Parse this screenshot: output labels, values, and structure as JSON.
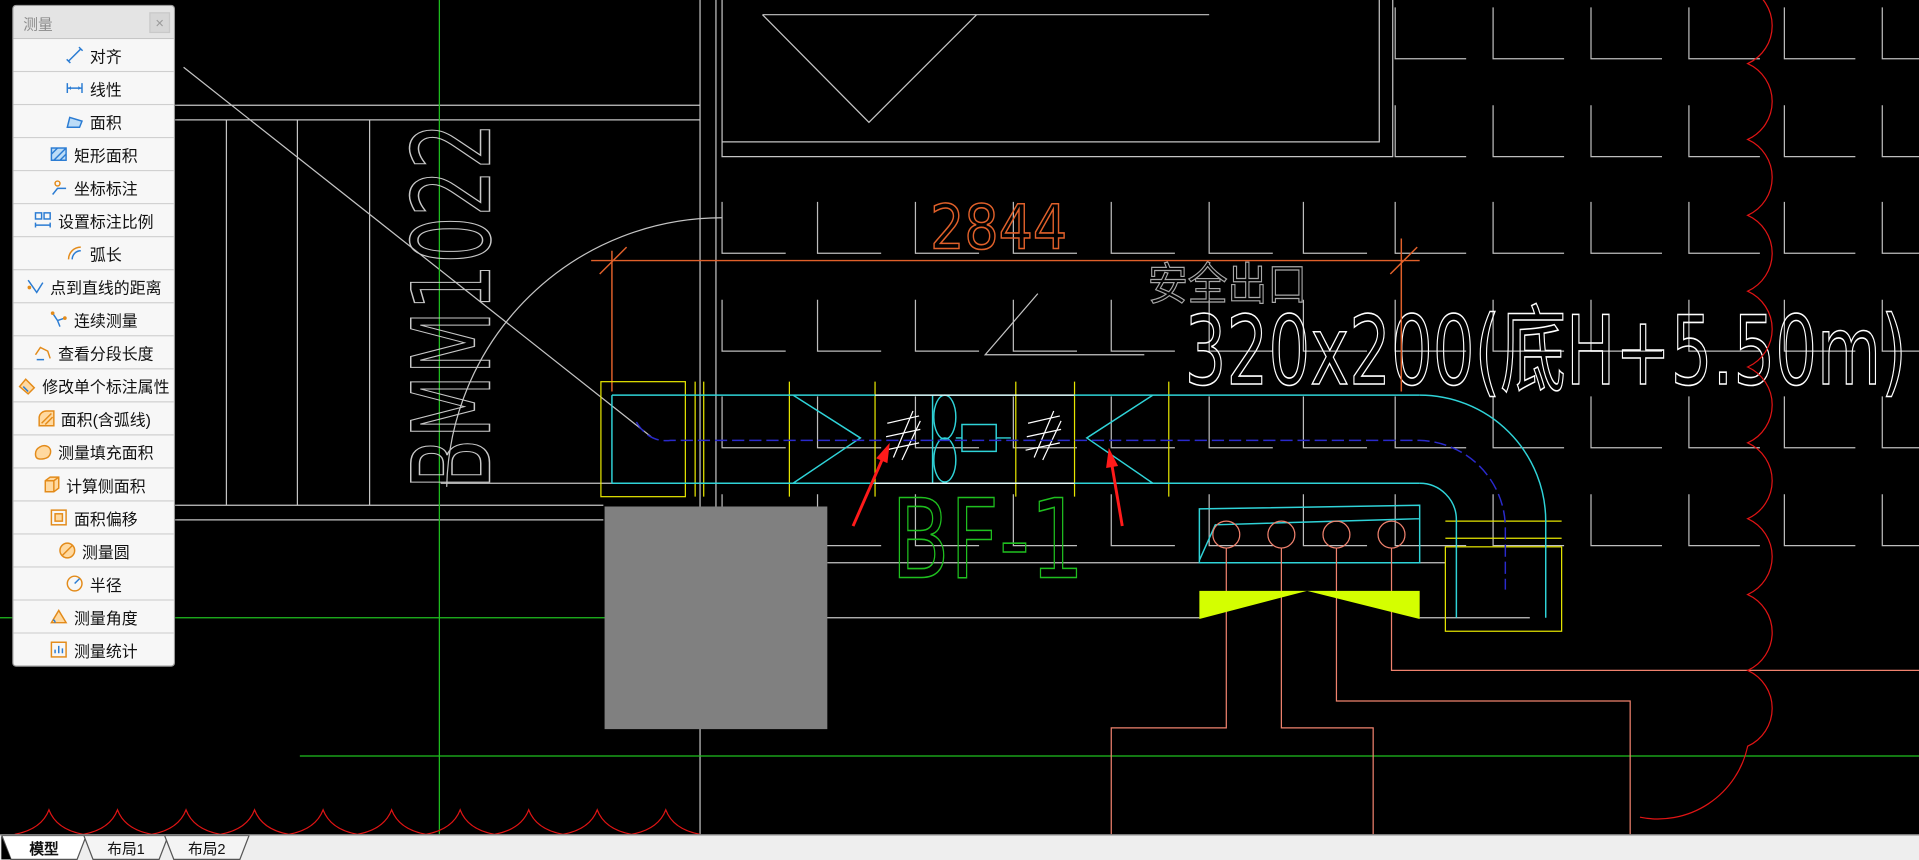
{
  "palette": {
    "title": "测量",
    "close_label": "×",
    "items": [
      {
        "label": "对齐",
        "icon": "align-icon"
      },
      {
        "label": "线性",
        "icon": "linear-dimension-icon"
      },
      {
        "label": "面积",
        "icon": "area-icon"
      },
      {
        "label": "矩形面积",
        "icon": "rect-area-icon"
      },
      {
        "label": "坐标标注",
        "icon": "coordinate-icon"
      },
      {
        "label": "设置标注比例",
        "icon": "scale-icon"
      },
      {
        "label": "弧长",
        "icon": "arc-length-icon"
      },
      {
        "label": "点到直线的距离",
        "icon": "point-to-line-icon"
      },
      {
        "label": "连续测量",
        "icon": "continuous-measure-icon"
      },
      {
        "label": "查看分段长度",
        "icon": "segment-length-icon"
      },
      {
        "label": "修改单个标注属性",
        "icon": "edit-dimension-icon"
      },
      {
        "label": "面积(含弧线)",
        "icon": "arc-area-icon"
      },
      {
        "label": "测量填充面积",
        "icon": "fill-area-icon"
      },
      {
        "label": "计算侧面积",
        "icon": "side-area-icon"
      },
      {
        "label": "面积偏移",
        "icon": "area-offset-icon"
      },
      {
        "label": "测量圆",
        "icon": "circle-icon"
      },
      {
        "label": "半径",
        "icon": "radius-icon"
      },
      {
        "label": "测量角度",
        "icon": "angle-icon"
      },
      {
        "label": "测量统计",
        "icon": "statistics-icon"
      }
    ]
  },
  "drawing": {
    "dimension_value": "2844",
    "exit_label": "安全出口",
    "duct_label": "320x200(底H+5.50m)",
    "equipment_label": "BF-1",
    "door_label": "BMM1022"
  },
  "tabs": [
    {
      "label": "模型",
      "active": true
    },
    {
      "label": "布局1",
      "active": false
    },
    {
      "label": "布局2",
      "active": false
    }
  ],
  "colors": {
    "canvas_background": "#000000",
    "architecture": "#c4c4c4",
    "axis_green": "#1fbf1f",
    "dimension_orange": "#e0602a",
    "duct_cyan": "#2fd3d8",
    "flange_yellow": "#e6e600",
    "centerline_blue": "#2a2acc",
    "annotation_arrow_red": "#ff1a1a",
    "revision_cloud_red": "#e01414",
    "pipe_salmon": "#f0826e",
    "grille_fill": "#d4ff00",
    "equipment_block_gray": "#808080"
  }
}
